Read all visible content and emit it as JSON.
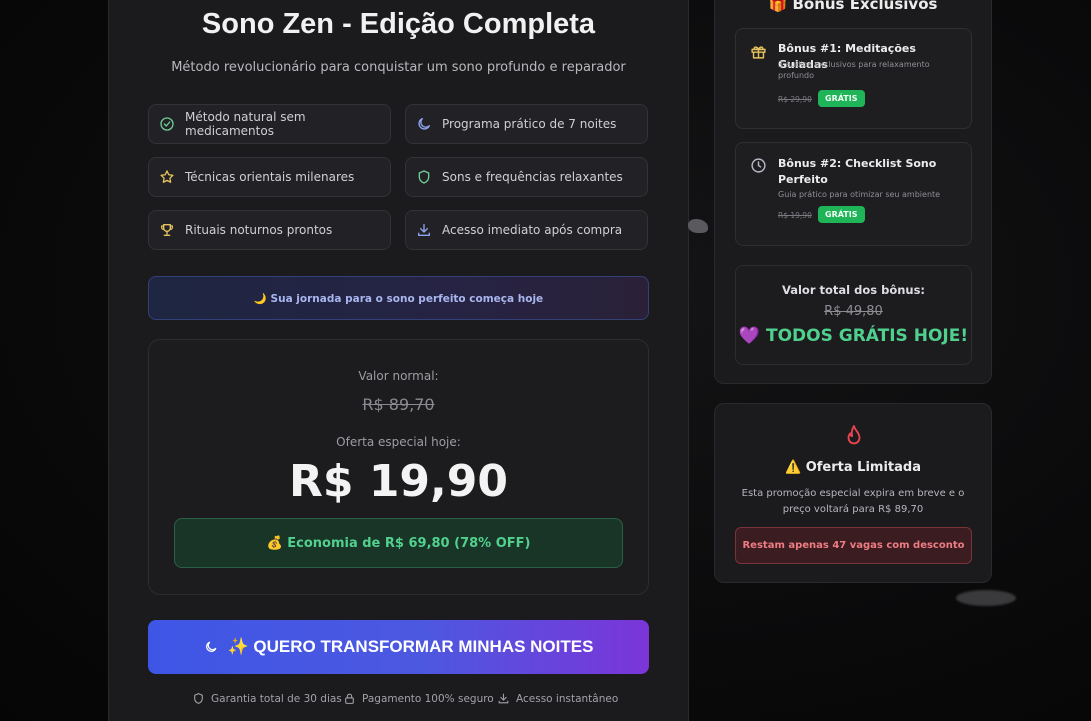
{
  "main": {
    "title": "Sono Zen - Edição Completa",
    "subtitle": "Método revolucionário para conquistar um sono profundo e reparador",
    "features": [
      {
        "label": "Método natural sem medicamentos",
        "icon": "check-circle-icon",
        "color": "#6fcf97"
      },
      {
        "label": "Programa prático de 7 noites",
        "icon": "moon-icon",
        "color": "#8fa4f0"
      },
      {
        "label": "Técnicas orientais milenares",
        "icon": "star-icon",
        "color": "#e6c35c"
      },
      {
        "label": "Sons e frequências relaxantes",
        "icon": "shield-icon",
        "color": "#6fcf97"
      },
      {
        "label": "Rituais noturnos prontos",
        "icon": "trophy-icon",
        "color": "#e6c35c"
      },
      {
        "label": "Acesso imediato após compra",
        "icon": "download-icon",
        "color": "#8fa4f0"
      }
    ],
    "journey": "🌙 Sua jornada para o sono perfeito começa hoje",
    "price": {
      "normal_label": "Valor normal:",
      "normal_value": "R$ 89,70",
      "special_label": "Oferta especial hoje:",
      "special_value": "R$ 19,90",
      "savings": "💰 Economia de R$ 69,80 (78% OFF)"
    },
    "cta_label": "✨ QUERO TRANSFORMAR MINHAS NOITES",
    "guarantees": [
      {
        "label": "Garantia total de 30 dias",
        "icon": "shield-icon"
      },
      {
        "label": "Pagamento 100% seguro",
        "icon": "lock-icon"
      },
      {
        "label": "Acesso instantâneo",
        "icon": "download-icon"
      }
    ]
  },
  "bonus": {
    "title": "🎁 Bônus Exclusivos",
    "items": [
      {
        "title": "Bônus #1: Meditações Guiadas",
        "desc": "3 áudios exclusivos para relaxamento profundo",
        "old_price": "R$ 29,90",
        "badge": "GRÁTIS",
        "icon": "gift-icon"
      },
      {
        "title": "Bônus #2: Checklist Sono Perfeito",
        "desc": "Guia prático para otimizar seu ambiente",
        "old_price": "R$ 19,90",
        "badge": "GRÁTIS",
        "icon": "clock-icon"
      }
    ],
    "total_label": "Valor total dos bônus:",
    "total_old": "R$ 49,80",
    "total_free": "💜 TODOS GRÁTIS HOJE!"
  },
  "offer": {
    "title": "⚠️ Oferta Limitada",
    "desc": "Esta promoção especial expira em breve e o preço voltará para R$ 89,70",
    "alert": "Restam apenas 47 vagas com desconto",
    "icon": "flame-icon",
    "alert_color": "#ee7c83"
  }
}
